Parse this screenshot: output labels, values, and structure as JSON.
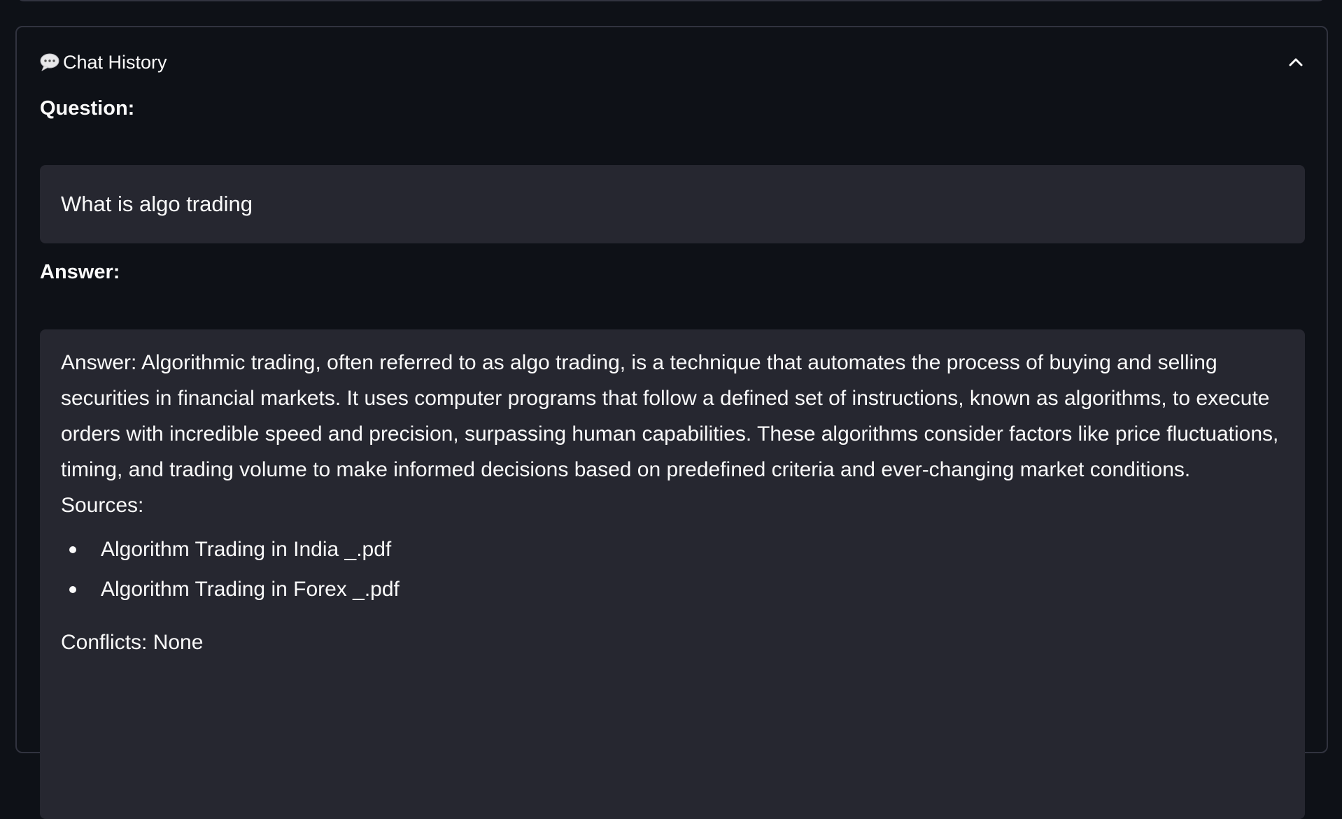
{
  "expander": {
    "title": "Chat History",
    "icon": "speech-bubble-icon",
    "collapse_icon": "chevron-up-icon",
    "expanded": true
  },
  "question": {
    "label": "Question:",
    "text": "What is algo trading"
  },
  "answer": {
    "label": "Answer:",
    "text": "Answer: Algorithmic trading, often referred to as algo trading, is a technique that automates the process of buying and selling securities in financial markets. It uses computer programs that follow a defined set of instructions, known as algorithms, to execute orders with incredible speed and precision, surpassing human capabilities. These algorithms consider factors like price fluctuations, timing, and trading volume to make informed decisions based on predefined criteria and ever-changing market conditions.",
    "sources_label": "Sources:",
    "sources": [
      "Algorithm Trading in India _.pdf",
      "Algorithm Trading in Forex _.pdf"
    ],
    "conflicts": "Conflicts: None"
  },
  "colors": {
    "background": "#0e1117",
    "block": "#262730",
    "border": "#31333f",
    "text": "#fafafa"
  }
}
